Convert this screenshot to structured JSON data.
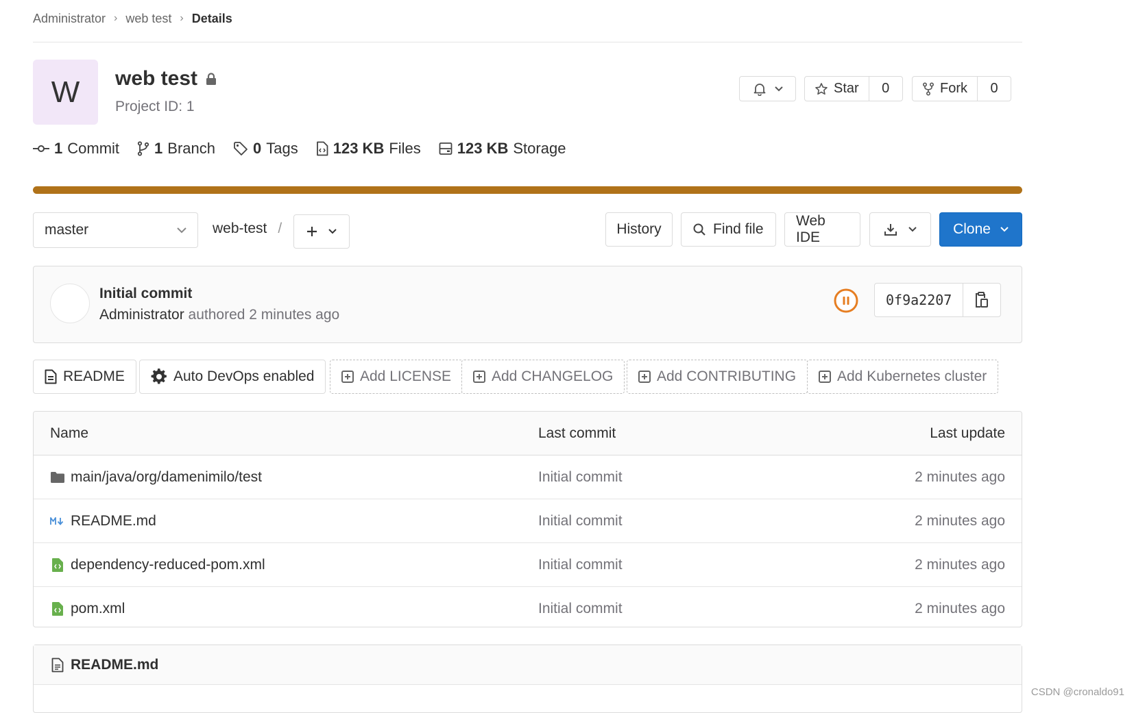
{
  "breadcrumb": {
    "items": [
      "Administrator",
      "web test"
    ],
    "current": "Details"
  },
  "project": {
    "avatar_letter": "W",
    "name": "web test",
    "id_text": "Project ID: 1",
    "star_label": "Star",
    "star_count": "0",
    "fork_label": "Fork",
    "fork_count": "0"
  },
  "stats": {
    "commits_num": "1",
    "commits_label": "Commit",
    "branches_num": "1",
    "branches_label": "Branch",
    "tags_num": "0",
    "tags_label": "Tags",
    "files_num": "123 KB",
    "files_label": "Files",
    "storage_num": "123 KB",
    "storage_label": "Storage"
  },
  "colors": {
    "language_bar": "#b07219",
    "clone_button": "#1f75cb",
    "pipeline_status": "#e67e22",
    "file_icon_green": "#68b04d",
    "markdown_icon_blue": "#4a90d9"
  },
  "tree": {
    "branch": "master",
    "path": "web-test",
    "path_sep": "/",
    "history": "History",
    "find_file": "Find file",
    "web_ide": "Web IDE",
    "clone": "Clone"
  },
  "last_commit": {
    "title": "Initial commit",
    "author": "Administrator",
    "meta": "authored 2 minutes ago",
    "sha": "0f9a2207"
  },
  "quick_actions": {
    "readme": "README",
    "auto_devops": "Auto DevOps enabled",
    "add_license": "Add LICENSE",
    "add_changelog": "Add CHANGELOG",
    "add_contributing": "Add CONTRIBUTING",
    "add_k8s": "Add Kubernetes cluster"
  },
  "files": {
    "headers": {
      "name": "Name",
      "last_commit": "Last commit",
      "last_update": "Last update"
    },
    "rows": [
      {
        "name": "main/java/org/damenimilo/test",
        "icon": "folder-icon",
        "commit": "Initial commit",
        "update": "2 minutes ago"
      },
      {
        "name": "README.md",
        "icon": "markdown-icon",
        "commit": "Initial commit",
        "update": "2 minutes ago"
      },
      {
        "name": "dependency-reduced-pom.xml",
        "icon": "xml-file-icon",
        "commit": "Initial commit",
        "update": "2 minutes ago"
      },
      {
        "name": "pom.xml",
        "icon": "xml-file-icon",
        "commit": "Initial commit",
        "update": "2 minutes ago"
      }
    ]
  },
  "readme_panel": {
    "title": "README.md"
  },
  "watermark": "CSDN @cronaldo91"
}
